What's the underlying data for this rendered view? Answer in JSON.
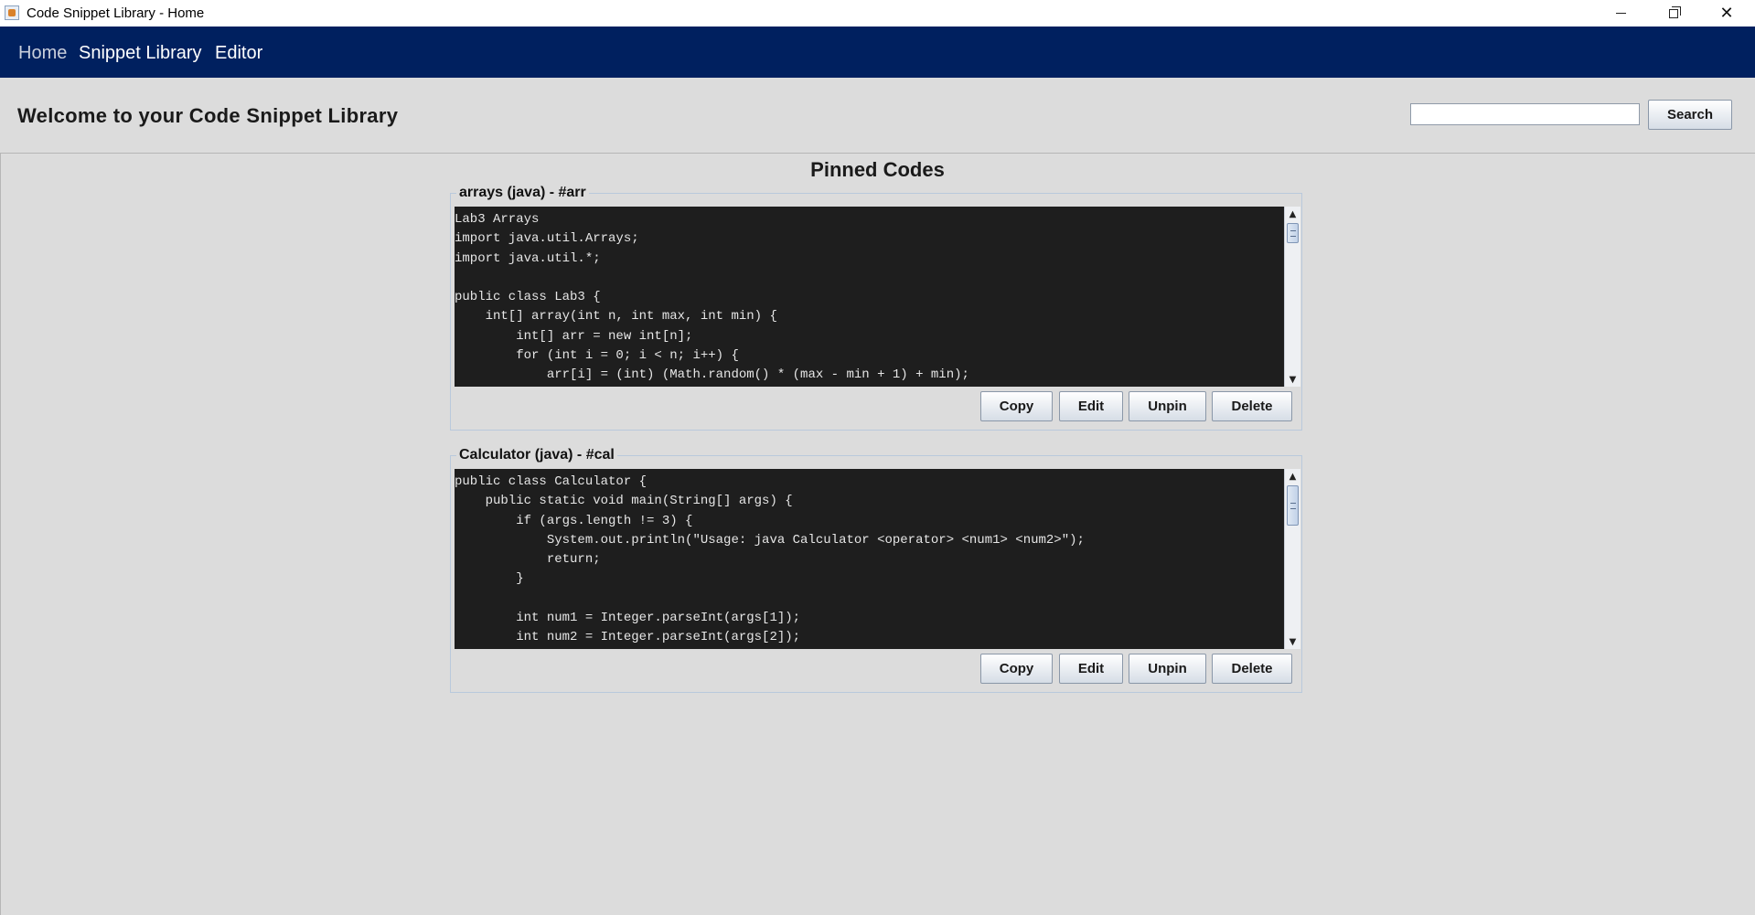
{
  "window": {
    "title": "Code Snippet Library - Home",
    "minimize_glyph": "",
    "close_glyph": "✕"
  },
  "nav": {
    "items": [
      {
        "label": "Home"
      },
      {
        "label": "Snippet Library"
      },
      {
        "label": "Editor"
      }
    ]
  },
  "header": {
    "title": "Welcome to your Code Snippet Library",
    "search_value": "",
    "search_button": "Search"
  },
  "main": {
    "section_title": "Pinned Codes",
    "snippets": [
      {
        "title": "arrays (java) - #arr",
        "code": "Lab3 Arrays\nimport java.util.Arrays;\nimport java.util.*;\n\npublic class Lab3 {\n    int[] array(int n, int max, int min) {\n        int[] arr = new int[n];\n        for (int i = 0; i < n; i++) {\n            arr[i] = (int) (Math.random() * (max - min + 1) + min);",
        "buttons": {
          "copy": "Copy",
          "edit": "Edit",
          "unpin": "Unpin",
          "delete": "Delete"
        }
      },
      {
        "title": "Calculator (java) - #cal",
        "code": "public class Calculator {\n    public static void main(String[] args) {\n        if (args.length != 3) {\n            System.out.println(\"Usage: java Calculator <operator> <num1> <num2>\");\n            return;\n        }\n\n        int num1 = Integer.parseInt(args[1]);\n        int num2 = Integer.parseInt(args[2]);",
        "buttons": {
          "copy": "Copy",
          "edit": "Edit",
          "unpin": "Unpin",
          "delete": "Delete"
        }
      }
    ]
  },
  "colors": {
    "navbar": "#00205f",
    "code_background": "#1e1e1e",
    "page_background": "#dcdcdc"
  },
  "icons": {
    "app": "java-app-icon",
    "minimize": "minimize-icon",
    "maximize": "restore-icon",
    "close": "close-icon",
    "scroll_up": "arrow-up-icon",
    "scroll_down": "arrow-down-icon"
  }
}
